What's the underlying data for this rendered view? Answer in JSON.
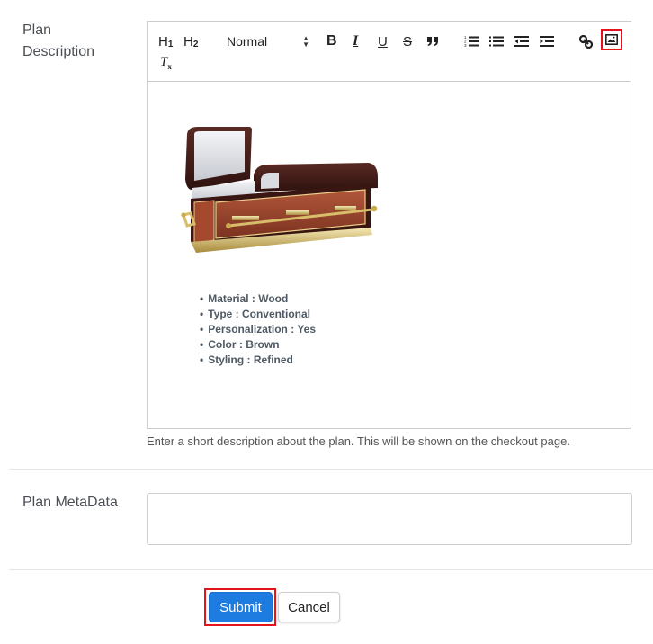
{
  "form": {
    "description_label": "Plan Description",
    "metadata_label": "Plan MetaData",
    "metadata_value": "",
    "help_text": "Enter a short description about the plan. This will be shown on the checkout page."
  },
  "toolbar": {
    "h1_label": "H",
    "h1_sub": "1",
    "h2_label": "H",
    "h2_sub": "2",
    "format_select": "Normal",
    "bold": "B",
    "italic": "I",
    "underline": "U",
    "strike": "S",
    "clear_format": "T",
    "clear_format_sub": "x",
    "icons": [
      "h1",
      "h2",
      "format-select",
      "bold",
      "italic",
      "underline",
      "strike",
      "blockquote",
      "ordered-list",
      "bullet-list",
      "outdent",
      "indent",
      "link",
      "image",
      "clear-format"
    ],
    "highlight_color": "#e4141c"
  },
  "editor": {
    "image_alt": "Wooden casket with brass handles",
    "specs": [
      "Material : Wood",
      "Type : Conventional",
      "Personalization : Yes",
      "Color : Brown",
      "Styling : Refined"
    ]
  },
  "actions": {
    "submit_label": "Submit",
    "cancel_label": "Cancel",
    "submit_color": "#1e7be0"
  }
}
